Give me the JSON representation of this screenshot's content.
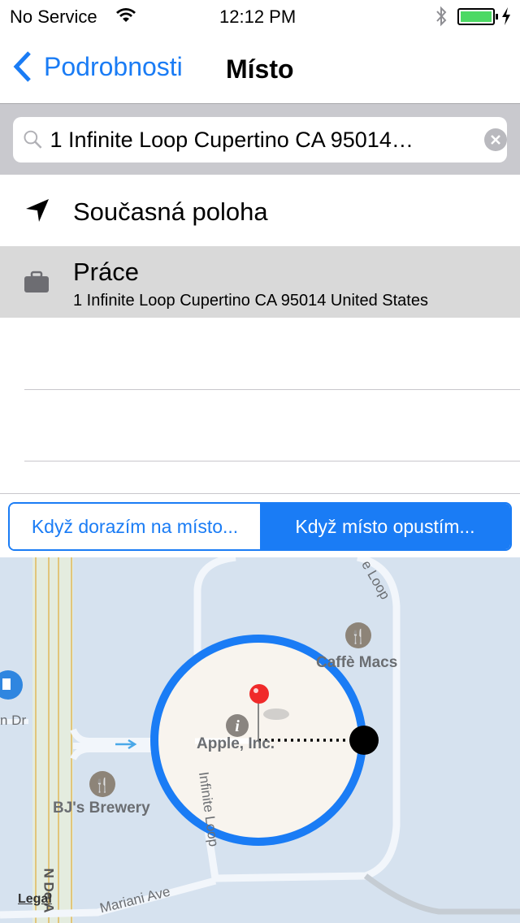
{
  "status": {
    "carrier": "No Service",
    "time": "12:12 PM",
    "battery_percent": 100,
    "charging": true,
    "icons": [
      "wifi-icon",
      "bluetooth-icon",
      "battery-icon",
      "charging-icon"
    ]
  },
  "nav": {
    "back_label": "Podrobnosti",
    "title": "Místo"
  },
  "search": {
    "value": "1 Infinite Loop Cupertino CA 95014…"
  },
  "list": [
    {
      "icon": "location-arrow-icon",
      "title": "Současná poloha"
    },
    {
      "icon": "briefcase-icon",
      "title": "Práce",
      "subtitle": "1 Infinite Loop Cupertino CA 95014 United States",
      "selected": true
    }
  ],
  "segment": {
    "options": [
      "Když dorazím na místo...",
      "Když místo opustím..."
    ],
    "selected_index": 1
  },
  "map": {
    "labels": {
      "poi_cafe": "Caffè Macs",
      "poi_brewery": "BJ's Brewery",
      "poi_apple": "Apple, Inc.",
      "street_infinite": "Infinite Loop",
      "street_mariani": "Mariani Ave",
      "street_loop": "e Loop",
      "street_dr": "n Dr",
      "street_nde": "N De A",
      "legal": "Legal"
    }
  },
  "colors": {
    "accent": "#1a7cf5",
    "selected_row": "#d9d9d9",
    "search_bg": "#c9c9ce",
    "battery": "#4cd964",
    "pin": "#f02a2a"
  }
}
